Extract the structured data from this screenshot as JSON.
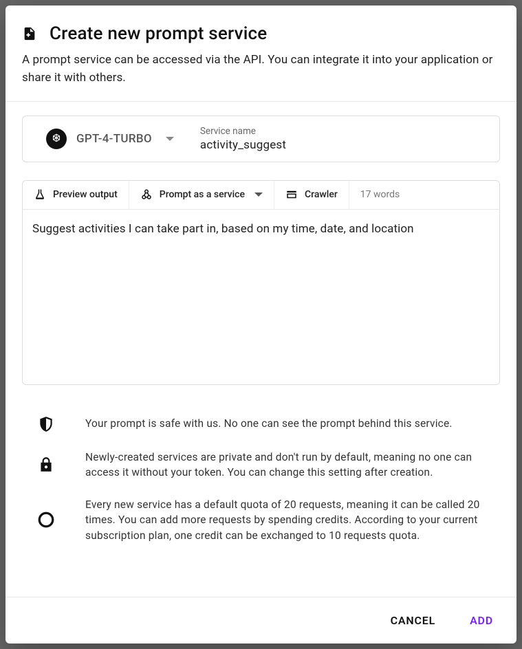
{
  "header": {
    "title": "Create new prompt service",
    "subtitle": "A prompt service can be accessed via the API. You can integrate it into your application or share it with others."
  },
  "config": {
    "model_name": "GPT-4-TURBO",
    "service_name_label": "Service name",
    "service_name_value": "activity_suggest"
  },
  "toolbar": {
    "preview_label": "Preview output",
    "paas_label": "Prompt as a service",
    "crawler_label": "Crawler",
    "word_count": "17 words"
  },
  "prompt_text": "Suggest activities I can take part in, based on my time, date, and location",
  "info": [
    {
      "text": "Your prompt is safe with us. No one can see the prompt behind this service."
    },
    {
      "text": "Newly-created services are private and don't run by default, meaning no one can access it without your token. You can change this setting after creation."
    },
    {
      "text": "Every new service has a default quota of 20 requests, meaning it can be called 20 times. You can add more requests by spending credits. According to your current subscription plan, one credit can be exchanged to 10 requests quota."
    }
  ],
  "footer": {
    "cancel_label": "CANCEL",
    "add_label": "ADD"
  }
}
